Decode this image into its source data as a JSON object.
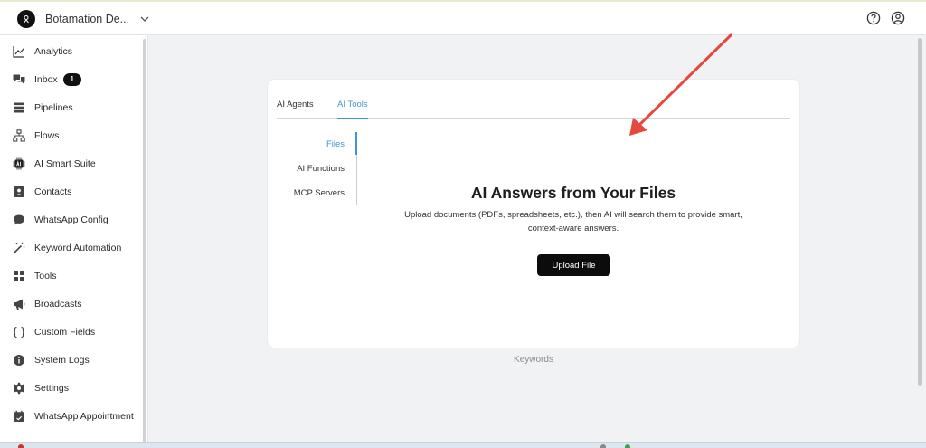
{
  "header": {
    "org_name": "Botamation De...",
    "icons": [
      "chevron-down-icon",
      "help-icon",
      "user-icon"
    ]
  },
  "sidebar": {
    "items": [
      {
        "label": "Analytics",
        "icon": "chart-line-icon"
      },
      {
        "label": "Inbox",
        "icon": "chat-icon",
        "badge": "1"
      },
      {
        "label": "Pipelines",
        "icon": "pipeline-icon"
      },
      {
        "label": "Flows",
        "icon": "flow-icon"
      },
      {
        "label": "AI Smart Suite",
        "icon": "ai-chip-icon"
      },
      {
        "label": "Contacts",
        "icon": "contact-card-icon"
      },
      {
        "label": "WhatsApp Config",
        "icon": "speech-bubble-icon"
      },
      {
        "label": "Keyword Automation",
        "icon": "magic-wand-icon"
      },
      {
        "label": "Tools",
        "icon": "grid-icon"
      },
      {
        "label": "Broadcasts",
        "icon": "megaphone-icon"
      },
      {
        "label": "Custom Fields",
        "icon": "braces-icon"
      },
      {
        "label": "System Logs",
        "icon": "info-icon"
      },
      {
        "label": "Settings",
        "icon": "gear-icon"
      },
      {
        "label": "WhatsApp Appointment",
        "icon": "calendar-check-icon"
      }
    ]
  },
  "main": {
    "tabs": [
      {
        "label": "AI Agents",
        "active": false
      },
      {
        "label": "AI Tools",
        "active": true
      }
    ],
    "subnav": [
      {
        "label": "Files",
        "active": true
      },
      {
        "label": "AI Functions",
        "active": false
      },
      {
        "label": "MCP Servers",
        "active": false
      }
    ],
    "hero": {
      "title": "AI Answers from Your Files",
      "description": "Upload documents (PDFs, spreadsheets, etc.), then AI will search them to provide smart, context-aware answers.",
      "button_label": "Upload File"
    },
    "footer_label": "Keywords"
  },
  "colors": {
    "accent": "#3f96d6",
    "button": "#0c0c0c",
    "annotation_arrow": "#e5483f"
  }
}
